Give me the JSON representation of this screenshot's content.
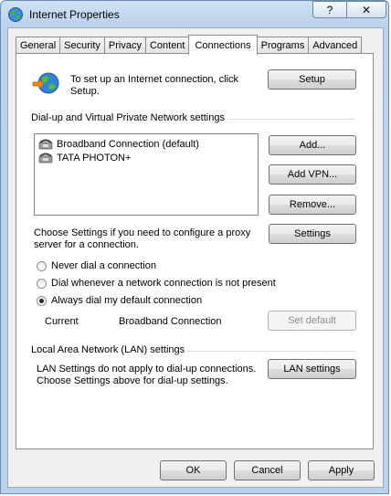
{
  "window": {
    "title": "Internet Properties",
    "help_label": "?",
    "close_label": "✕"
  },
  "tabs": [
    {
      "label": "General"
    },
    {
      "label": "Security"
    },
    {
      "label": "Privacy"
    },
    {
      "label": "Content"
    },
    {
      "label": "Connections"
    },
    {
      "label": "Programs"
    },
    {
      "label": "Advanced"
    }
  ],
  "active_tab": "Connections",
  "setup": {
    "text_line1": "To set up an Internet connection, click",
    "text_line2": "Setup.",
    "button": "Setup"
  },
  "dialup": {
    "section_title": "Dial-up and Virtual Private Network settings",
    "connections": [
      {
        "label": "Broadband Connection (default)"
      },
      {
        "label": "TATA PHOTON+"
      }
    ],
    "add_button": "Add...",
    "add_vpn_button": "Add VPN...",
    "remove_button": "Remove...",
    "settings_text_line1": "Choose Settings if you need to configure a proxy",
    "settings_text_line2": "server for a connection.",
    "settings_button": "Settings",
    "radio_never": "Never dial a connection",
    "radio_whenever": "Dial whenever a network connection is not present",
    "radio_always": "Always dial my default connection",
    "selected": "always",
    "current_label": "Current",
    "current_value": "Broadband Connection",
    "set_default_button": "Set default"
  },
  "lan": {
    "section_title": "Local Area Network (LAN) settings",
    "text_line1": "LAN Settings do not apply to dial-up connections.",
    "text_line2": "Choose Settings above for dial-up settings.",
    "button": "LAN settings"
  },
  "footer": {
    "ok": "OK",
    "cancel": "Cancel",
    "apply": "Apply"
  }
}
